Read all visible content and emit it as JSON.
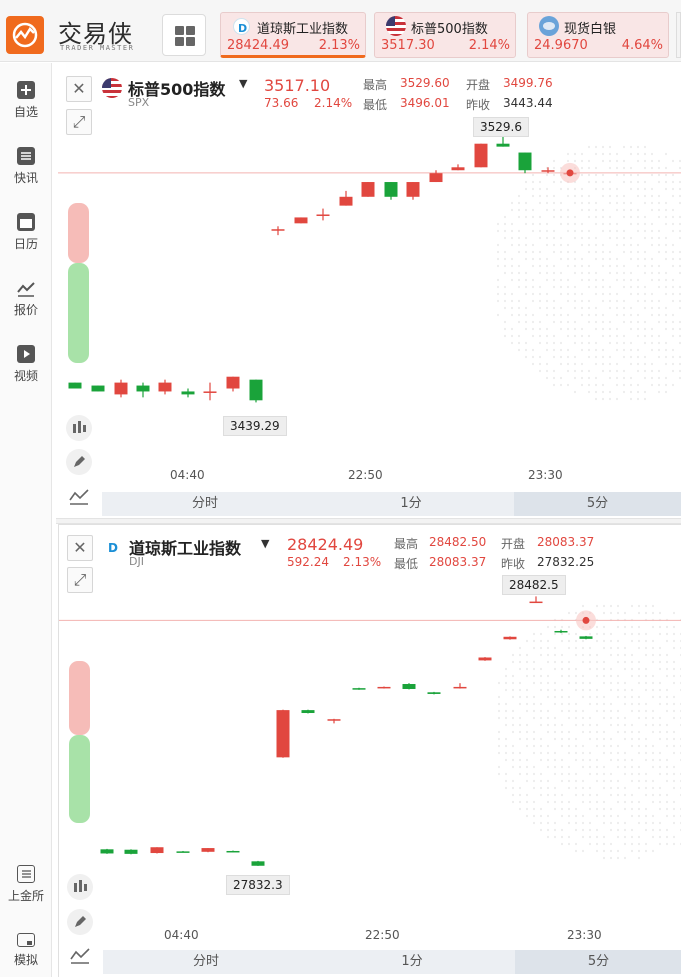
{
  "app": {
    "logo_text": "交易侠",
    "logo_sub": "TRADER MASTER"
  },
  "tickers": [
    {
      "name": "道琼斯工业指数",
      "price": "28424.49",
      "pct": "2.13%",
      "icon": "dj-logo-icon"
    },
    {
      "name": "标普500指数",
      "price": "3517.30",
      "pct": "2.14%",
      "icon": "us-flag-icon"
    },
    {
      "name": "现货白银",
      "price": "24.9670",
      "pct": "4.64%",
      "icon": "silver-icon"
    }
  ],
  "sidebar": {
    "items": [
      {
        "label": "自选",
        "icon": "plus-square-icon"
      },
      {
        "label": "快讯",
        "icon": "list-icon"
      },
      {
        "label": "日历",
        "icon": "calendar-icon"
      },
      {
        "label": "报价",
        "icon": "line-chart-icon"
      },
      {
        "label": "视频",
        "icon": "play-icon"
      }
    ],
    "bottom_items": [
      {
        "label": "上金所",
        "icon": "exchange-icon"
      },
      {
        "label": "模拟",
        "icon": "wallet-icon"
      }
    ]
  },
  "colors": {
    "up": "#e1473f",
    "down": "#1aa33a",
    "accent": "#f06a1d"
  },
  "panels": [
    {
      "title": "标普500指数",
      "code": "SPX",
      "price": "3517.10",
      "change": "73.66",
      "change_pct": "2.14%",
      "high_label": "最高",
      "high": "3529.60",
      "open_label": "开盘",
      "open": "3499.76",
      "low_label": "最低",
      "low": "3496.01",
      "prev_label": "昨收",
      "prev": "3443.44",
      "callout_high": "3529.6",
      "callout_low": "3439.29",
      "x_labels": [
        "04:40",
        "22:50",
        "23:30"
      ],
      "tabs": [
        "分时",
        "1分",
        "5分"
      ],
      "selected_tab": "5分"
    },
    {
      "title": "道琼斯工业指数",
      "code": "DJI",
      "price": "28424.49",
      "change": "592.24",
      "change_pct": "2.13%",
      "high_label": "最高",
      "high": "28482.50",
      "open_label": "开盘",
      "open": "28083.37",
      "low_label": "最低",
      "low": "28083.37",
      "prev_label": "昨收",
      "prev": "27832.25",
      "callout_high": "28482.5",
      "callout_low": "27832.3",
      "x_labels": [
        "04:40",
        "22:50",
        "23:30"
      ],
      "tabs": [
        "分时",
        "1分",
        "5分"
      ],
      "selected_tab": "5分"
    }
  ],
  "chart_data": [
    {
      "type": "candlestick",
      "title": "标普500指数",
      "x": [
        "04:40",
        "22:50",
        "23:30"
      ],
      "candles": [
        {
          "o": 3446,
          "c": 3444,
          "h": 3446,
          "l": 3444
        },
        {
          "o": 3445,
          "c": 3443,
          "h": 3445,
          "l": 3443
        },
        {
          "o": 3442,
          "c": 3446,
          "h": 3447,
          "l": 3441
        },
        {
          "o": 3445,
          "c": 3443,
          "h": 3446,
          "l": 3441
        },
        {
          "o": 3443,
          "c": 3446,
          "h": 3447,
          "l": 3442
        },
        {
          "o": 3443,
          "c": 3442,
          "h": 3444,
          "l": 3441
        },
        {
          "o": 3443,
          "c": 3443,
          "h": 3446,
          "l": 3440
        },
        {
          "o": 3444,
          "c": 3448,
          "h": 3448,
          "l": 3443
        },
        {
          "o": 3447,
          "c": 3440,
          "h": 3447,
          "l": 3439.29
        },
        {
          "o": 3498,
          "c": 3498,
          "h": 3499,
          "l": 3496
        },
        {
          "o": 3500,
          "c": 3502,
          "h": 3502,
          "l": 3500
        },
        {
          "o": 3503,
          "c": 3503,
          "h": 3505,
          "l": 3501
        },
        {
          "o": 3506,
          "c": 3509,
          "h": 3511,
          "l": 3506
        },
        {
          "o": 3509,
          "c": 3514,
          "h": 3514,
          "l": 3509
        },
        {
          "o": 3514,
          "c": 3509,
          "h": 3514,
          "l": 3508
        },
        {
          "o": 3509,
          "c": 3514,
          "h": 3514,
          "l": 3508
        },
        {
          "o": 3514,
          "c": 3517,
          "h": 3518,
          "l": 3514
        },
        {
          "o": 3518,
          "c": 3519,
          "h": 3520,
          "l": 3518
        },
        {
          "o": 3519,
          "c": 3527,
          "h": 3527,
          "l": 3519
        },
        {
          "o": 3527,
          "c": 3526,
          "h": 3529.6,
          "l": 3526
        },
        {
          "o": 3524,
          "c": 3518,
          "h": 3524,
          "l": 3517
        },
        {
          "o": 3518,
          "c": 3518,
          "h": 3519,
          "l": 3517
        },
        {
          "o": 3517,
          "c": 3517.1,
          "h": 3518,
          "l": 3516
        }
      ],
      "prev_close": 3517.1,
      "ylim": [
        3434,
        3533
      ]
    },
    {
      "type": "candlestick",
      "title": "道琼斯工业指数",
      "x": [
        "04:40",
        "22:50",
        "23:30"
      ],
      "candles": [
        {
          "o": 27872,
          "c": 27862,
          "h": 27873,
          "l": 27861
        },
        {
          "o": 27871,
          "c": 27861,
          "h": 27872,
          "l": 27860
        },
        {
          "o": 27863,
          "c": 27877,
          "h": 27877,
          "l": 27862
        },
        {
          "o": 27867,
          "c": 27866,
          "h": 27868,
          "l": 27865
        },
        {
          "o": 27866,
          "c": 27875,
          "h": 27875,
          "l": 27865
        },
        {
          "o": 27868,
          "c": 27866,
          "h": 27869,
          "l": 27865
        },
        {
          "o": 27843,
          "c": 27832.3,
          "h": 27844,
          "l": 27832
        },
        {
          "o": 28094,
          "c": 28208,
          "h": 28209,
          "l": 28093
        },
        {
          "o": 28208,
          "c": 28201,
          "h": 28209,
          "l": 28200
        },
        {
          "o": 28184,
          "c": 28186,
          "h": 28187,
          "l": 28176
        },
        {
          "o": 28261,
          "c": 28258,
          "h": 28262,
          "l": 28257
        },
        {
          "o": 28261,
          "c": 28264,
          "h": 28265,
          "l": 28260
        },
        {
          "o": 28271,
          "c": 28259,
          "h": 28273,
          "l": 28258
        },
        {
          "o": 28251,
          "c": 28247,
          "h": 28252,
          "l": 28246
        },
        {
          "o": 28261,
          "c": 28264,
          "h": 28273,
          "l": 28260
        },
        {
          "o": 28328,
          "c": 28335,
          "h": 28336,
          "l": 28327
        },
        {
          "o": 28379,
          "c": 28385,
          "h": 28386,
          "l": 28378
        },
        {
          "o": 28468,
          "c": 28470,
          "h": 28482.5,
          "l": 28467
        },
        {
          "o": 28399,
          "c": 28396,
          "h": 28402,
          "l": 28394
        },
        {
          "o": 28386,
          "c": 28380,
          "h": 28387,
          "l": 28379
        }
      ],
      "prev_close": 28424.49,
      "ylim": [
        27810,
        28510
      ]
    }
  ]
}
